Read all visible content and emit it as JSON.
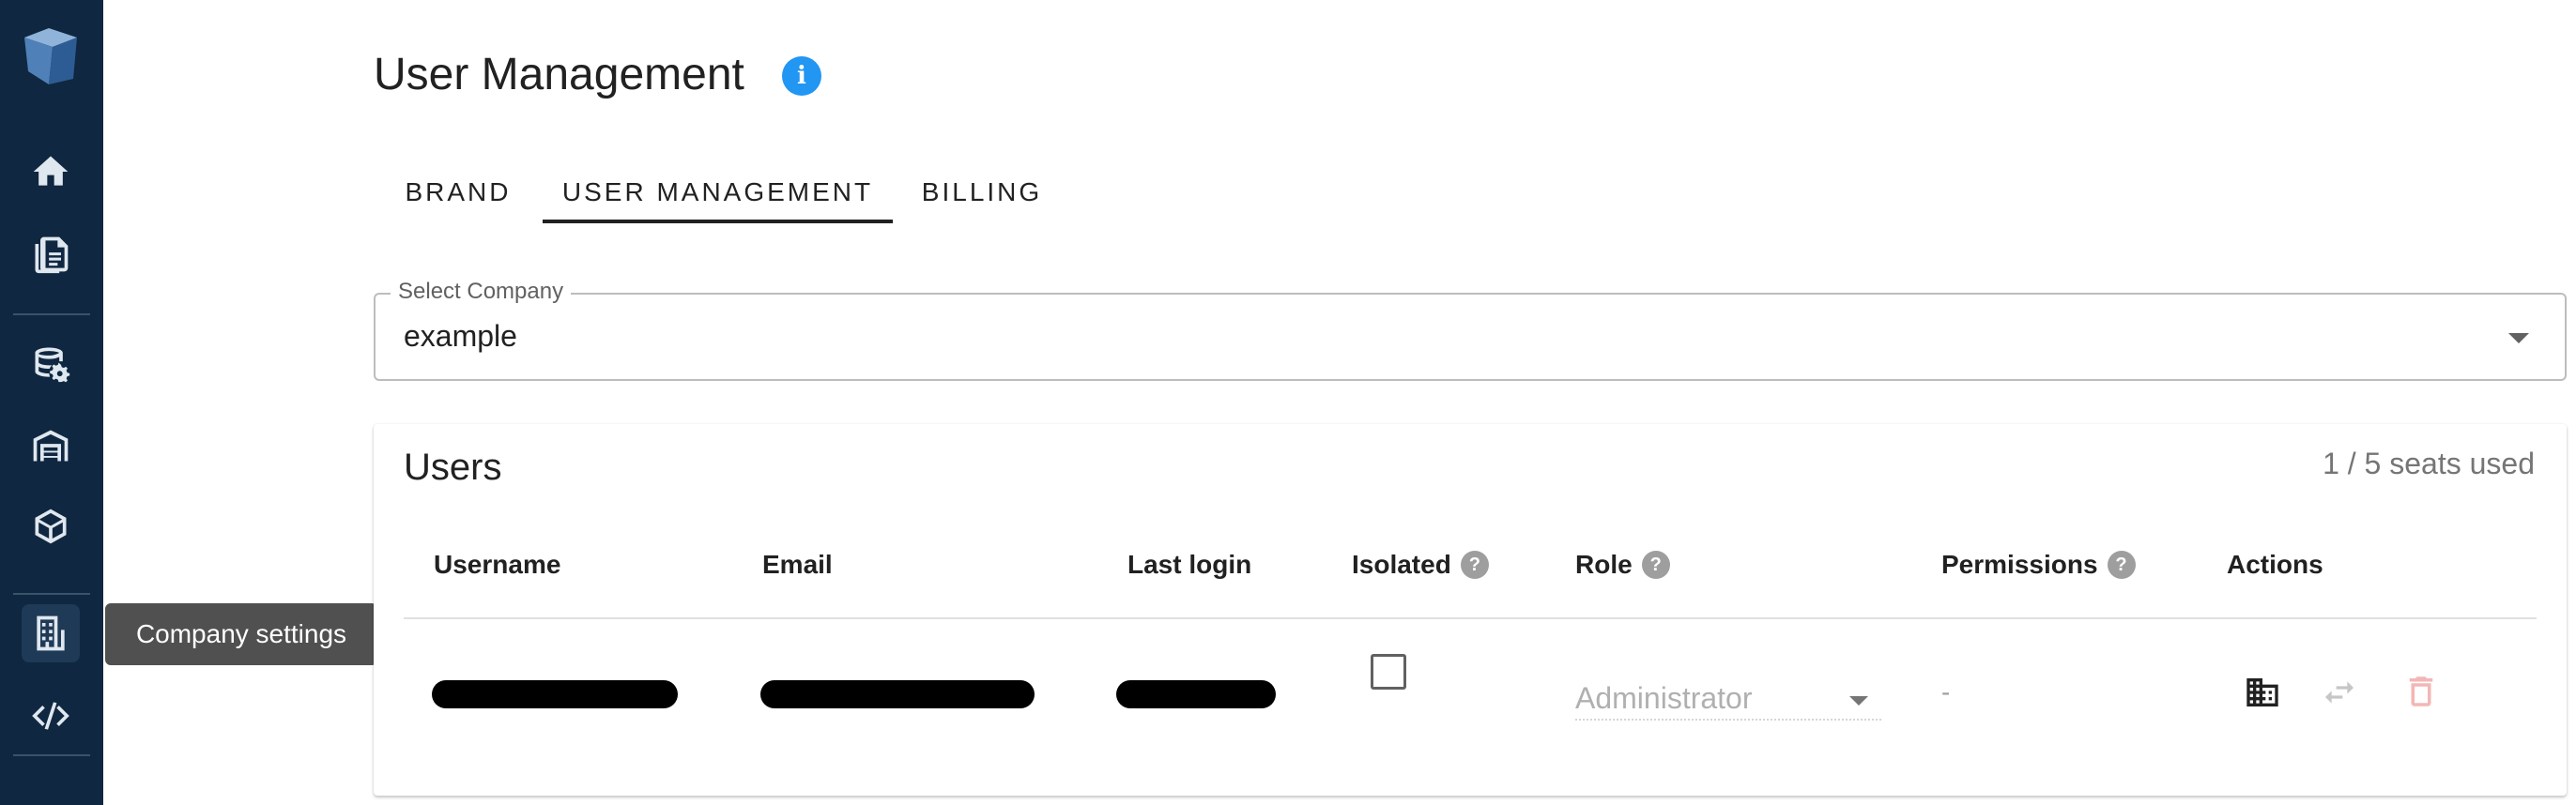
{
  "sidebar": {
    "items": [
      {
        "name": "home-icon"
      },
      {
        "name": "documents-icon"
      },
      {
        "name": "database-settings-icon"
      },
      {
        "name": "warehouse-icon"
      },
      {
        "name": "package-icon"
      },
      {
        "name": "company-icon",
        "active": true
      },
      {
        "name": "code-icon"
      }
    ],
    "tooltip": "Company settings"
  },
  "header": {
    "title": "User Management"
  },
  "tabs": [
    {
      "label": "BRAND"
    },
    {
      "label": "USER MANAGEMENT",
      "active": true
    },
    {
      "label": "BILLING"
    }
  ],
  "company_select": {
    "label": "Select Company",
    "value": "example"
  },
  "users": {
    "title": "Users",
    "seats": "1 / 5 seats used",
    "columns": [
      "Username",
      "Email",
      "Last login",
      "Isolated",
      "Role",
      "Permissions",
      "Actions"
    ],
    "rows": [
      {
        "isolated": false,
        "role": "Administrator",
        "permissions": "-"
      }
    ]
  },
  "colors": {
    "sidebar_bg": "#0f2740",
    "accent": "#2196f3",
    "delete_disabled": "#f3b6b6"
  }
}
